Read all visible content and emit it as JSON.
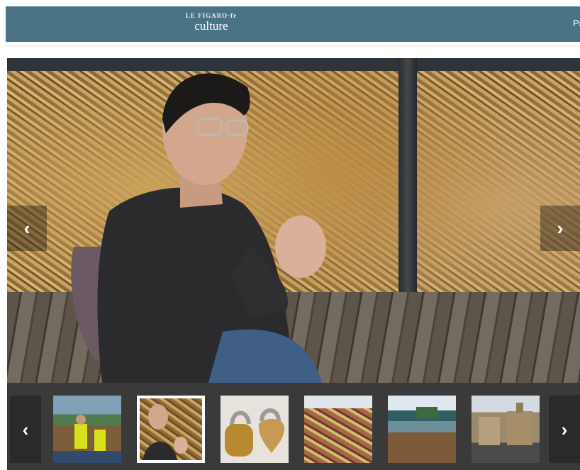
{
  "header": {
    "brand_top": "LE FIGARO·fr",
    "brand_main": "culture",
    "edge_text": "Pr"
  },
  "gallery": {
    "prev_glyph": "‹",
    "next_glyph": "›",
    "strip_prev_glyph": "‹",
    "strip_next_glyph": "›",
    "active_thumbnail_index": 1,
    "thumbnail_count": 6
  },
  "colors": {
    "header_bg": "#4a7485",
    "strip_bg": "#3a3a3a",
    "active_outline": "#ffffff"
  },
  "icons": {
    "prev": "chevron-left-icon",
    "next": "chevron-right-icon"
  }
}
